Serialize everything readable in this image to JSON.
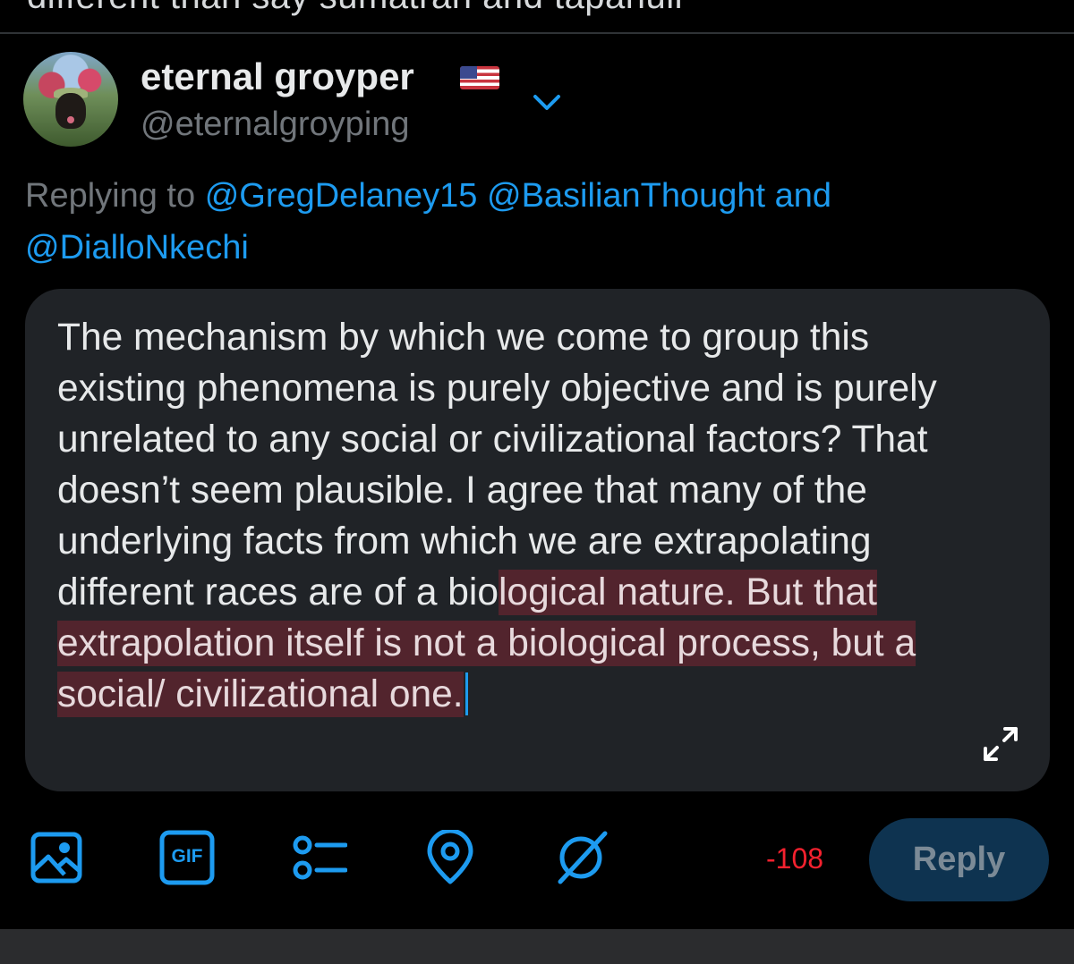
{
  "previous_tweet": {
    "cutoff_text": "different than say sumatran and tapanuli"
  },
  "author": {
    "display_name": "eternal groyper",
    "flag_icon": "us-flag-icon",
    "handle": "@eternalgroyping",
    "chevron_icon": "chevron-down-icon"
  },
  "replying_to": {
    "prefix": "Replying to",
    "mentions": [
      "@GregDelaney15",
      "@BasilianThought"
    ],
    "joiner": "and",
    "last_mention": "@DialloNkechi"
  },
  "compose": {
    "text_unselected": "The mechanism by which we come to group this existing phenomena is purely objective and is purely unrelated to any social or civilizational factors? That doesn’t seem plausible. I agree that many of the underlying facts from which we are extrapolating different races are of a bio",
    "text_selected": "logical nature. But that extrapolation itself is not a biological process, but a social/ civilizational one.",
    "expand_icon": "expand-arrows-icon"
  },
  "toolbar": {
    "icons": [
      "image-icon",
      "gif-icon",
      "poll-icon",
      "location-icon",
      "circle-slash-icon"
    ],
    "gif_label": "GIF",
    "char_count": "-108",
    "reply_label": "Reply"
  },
  "colors": {
    "accent": "#1d9bf0",
    "background": "#000000",
    "compose_bg": "#202327",
    "error": "#f4212e",
    "reply_disabled_bg": "#0e3350"
  }
}
